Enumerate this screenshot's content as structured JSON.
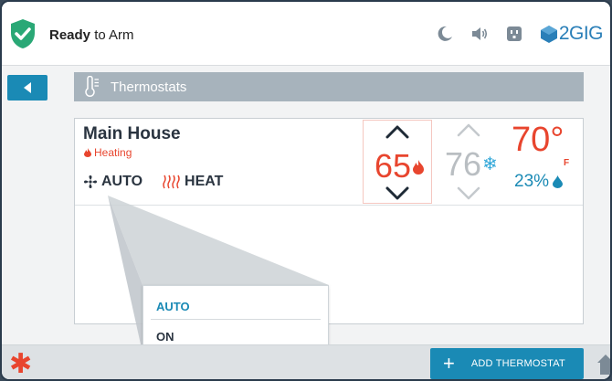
{
  "status": {
    "label_bold": "Ready",
    "label_rest": " to Arm",
    "color": "#2aa876"
  },
  "brand": {
    "text": "2GIG"
  },
  "header": {
    "title": "Thermostats"
  },
  "thermostat": {
    "name": "Main House",
    "state": "Heating",
    "fan_mode": "AUTO",
    "system_mode": "HEAT",
    "heat_setpoint": "65",
    "cool_setpoint": "76",
    "current_temp": "70°",
    "unit": "F",
    "humidity": "23%"
  },
  "dropdown": {
    "options": [
      "AUTO",
      "ON"
    ],
    "selected": "AUTO"
  },
  "bottom": {
    "add_label": "ADD THERMOSTAT"
  },
  "colors": {
    "accent": "#1a8ab5",
    "heat": "#e8452e",
    "cool": "#2fa6d8",
    "header": "#a7b3bc"
  }
}
